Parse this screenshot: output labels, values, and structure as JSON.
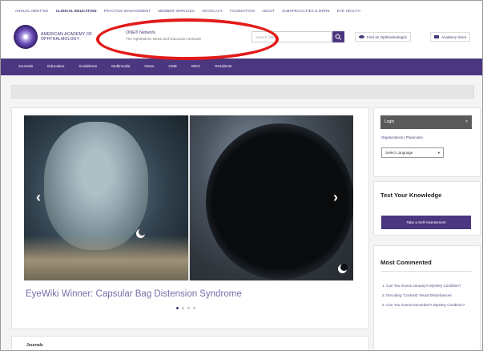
{
  "topnav": {
    "items": [
      "Annual Meeting",
      "Clinical Education",
      "Practice Management",
      "Member Services",
      "Advocacy",
      "Foundation",
      "About",
      "Subspecialties & More",
      "Eye Health"
    ],
    "active_index": 1
  },
  "header": {
    "logo_text": "American Academy of Ophthalmology",
    "network_title": "ONE® Network",
    "network_subtitle": "The Ophthalmic News and Education Network",
    "search_placeholder": "Search ONE",
    "find_ophthalmologist": "Find an Ophthalmologist",
    "product_store": "Academy Store"
  },
  "mainnav": {
    "items": [
      "Journals",
      "Education",
      "Guidelines",
      "Multimedia",
      "News",
      "CME",
      "MOC",
      "Residents"
    ]
  },
  "carousel": {
    "headline": "EyeWiki Winner: Capsular Bag Distension Syndrome",
    "slide_count": 4,
    "active_slide": 0
  },
  "journals": {
    "title": "Journals"
  },
  "sidebar": {
    "login_label": "Login",
    "login_close": "×",
    "links": "Organizations  |  Physicians",
    "language_select": "Select Language",
    "tyk_title": "Test Your Knowledge",
    "tyk_button": "Take a Self-Assessment",
    "mc_title": "Most Commented",
    "mc_items": [
      "1. Can You Guess January's Mystery Condition?",
      "2. Decoding 'Contrast' Visual Disturbances",
      "3. Can You Guess December's Mystery Condition?"
    ]
  },
  "colors": {
    "brand_purple": "#4a3780",
    "annotation_red": "#e21a1a"
  }
}
